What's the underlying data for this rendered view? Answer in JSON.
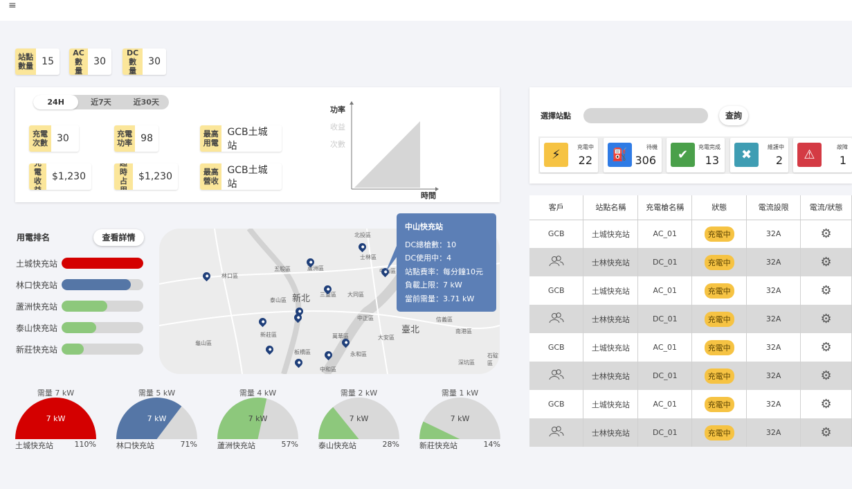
{
  "header": {
    "menu_icon": "≡"
  },
  "summary": [
    {
      "label": "站點數量",
      "value": "15"
    },
    {
      "label": "AC數量",
      "value": "30"
    },
    {
      "label": "DC數量",
      "value": "30"
    }
  ],
  "period_toggle": {
    "options": [
      "24H",
      "近7天",
      "近30天"
    ],
    "selected": "24H"
  },
  "kpis": [
    {
      "label": "充電次數",
      "value": "30"
    },
    {
      "label": "充電功率",
      "value": "98"
    },
    {
      "label": "最高用電",
      "value": "GCB土城站"
    },
    {
      "label": "充電收益",
      "value": "$1,230"
    },
    {
      "label": "超時占用",
      "value": "$1,230"
    },
    {
      "label": "最高營收",
      "value": "GCB土城站"
    }
  ],
  "mini_chart": {
    "y_options": [
      "功率",
      "收益",
      "次數"
    ],
    "selected": "功率",
    "xlabel": "時間"
  },
  "ranking": {
    "title": "用電排名",
    "details_button": "查看詳情",
    "items": [
      {
        "name": "土城快充站",
        "fraction": 1.0,
        "color": "#d40000"
      },
      {
        "name": "林口快充站",
        "fraction": 0.85,
        "color": "#5576a6"
      },
      {
        "name": "蘆洲快充站",
        "fraction": 0.56,
        "color": "#8dc87c"
      },
      {
        "name": "泰山快充站",
        "fraction": 0.42,
        "color": "#8dc87c"
      },
      {
        "name": "新莊快充站",
        "fraction": 0.27,
        "color": "#8dc87c"
      }
    ]
  },
  "map": {
    "labels": [
      "北投區",
      "士林區",
      "中山區",
      "五股區",
      "蘆洲區",
      "林口區",
      "新北",
      "三重區",
      "泰山區",
      "大同區",
      "中正區",
      "臺北",
      "新莊區",
      "大安區",
      "龜山區",
      "板橋區",
      "萬華區",
      "永和區",
      "中和區",
      "汐止區",
      "南港區",
      "信義區",
      "深坑區",
      "石碇區"
    ],
    "tooltip": {
      "title": "中山快充站",
      "lines": [
        "DC總槍數：10",
        "DC使用中：4",
        "站點費率：每分鐘10元",
        "負載上限：7 kW",
        "當前需量：3.71 kW"
      ]
    }
  },
  "gauges": [
    {
      "title": "需量 7 kW",
      "center": "7 kW",
      "station": "土城快充站",
      "percent": "110%",
      "value": 1.1,
      "color": "#d40000"
    },
    {
      "title": "需量 5 kW",
      "center": "7 kW",
      "station": "林口快充站",
      "percent": "71%",
      "value": 0.71,
      "color": "#5576a6"
    },
    {
      "title": "需量 4 kW",
      "center": "7 kW",
      "station": "蘆洲快充站",
      "percent": "57%",
      "value": 0.57,
      "color": "#8dc87c"
    },
    {
      "title": "需量 2 kW",
      "center": "7 kW",
      "station": "泰山快充站",
      "percent": "28%",
      "value": 0.28,
      "color": "#8dc87c"
    },
    {
      "title": "需量 1 kW",
      "center": "7 kW",
      "station": "新莊快充站",
      "percent": "14%",
      "value": 0.14,
      "color": "#8dc87c"
    }
  ],
  "station_select": {
    "label": "選擇站點",
    "value": "",
    "query_button": "查詢"
  },
  "status_cards": [
    {
      "label": "充電中",
      "count": "22",
      "icon": "lightning-icon",
      "color": "#f6c343"
    },
    {
      "label": "待機",
      "count": "306",
      "icon": "fuel-pump-icon",
      "color": "#2f7be5"
    },
    {
      "label": "充電完成",
      "count": "13",
      "icon": "check-circle-icon",
      "color": "#4aa04a"
    },
    {
      "label": "維護中",
      "count": "2",
      "icon": "tools-icon",
      "color": "#3f9db3"
    },
    {
      "label": "故障",
      "count": "1",
      "icon": "warning-icon",
      "color": "#d43a44"
    }
  ],
  "table": {
    "headers": [
      "客戶",
      "站點名稱",
      "充電槍名稱",
      "狀態",
      "電流設限",
      "電流/狀態"
    ],
    "rows": [
      {
        "customer": "GCB",
        "station": "土城快充站",
        "gun": "AC_01",
        "status": "充電中",
        "limit": "32A"
      },
      {
        "customer": "",
        "station": "士林快充站",
        "gun": "DC_01",
        "status": "充電中",
        "limit": "32A"
      },
      {
        "customer": "GCB",
        "station": "土城快充站",
        "gun": "AC_01",
        "status": "充電中",
        "limit": "32A"
      },
      {
        "customer": "",
        "station": "士林快充站",
        "gun": "DC_01",
        "status": "充電中",
        "limit": "32A"
      },
      {
        "customer": "GCB",
        "station": "土城快充站",
        "gun": "AC_01",
        "status": "充電中",
        "limit": "32A"
      },
      {
        "customer": "",
        "station": "士林快充站",
        "gun": "DC_01",
        "status": "充電中",
        "limit": "32A"
      },
      {
        "customer": "GCB",
        "station": "土城快充站",
        "gun": "AC_01",
        "status": "充電中",
        "limit": "32A"
      },
      {
        "customer": "",
        "station": "士林快充站",
        "gun": "DC_01",
        "status": "充電中",
        "limit": "32A"
      }
    ]
  }
}
